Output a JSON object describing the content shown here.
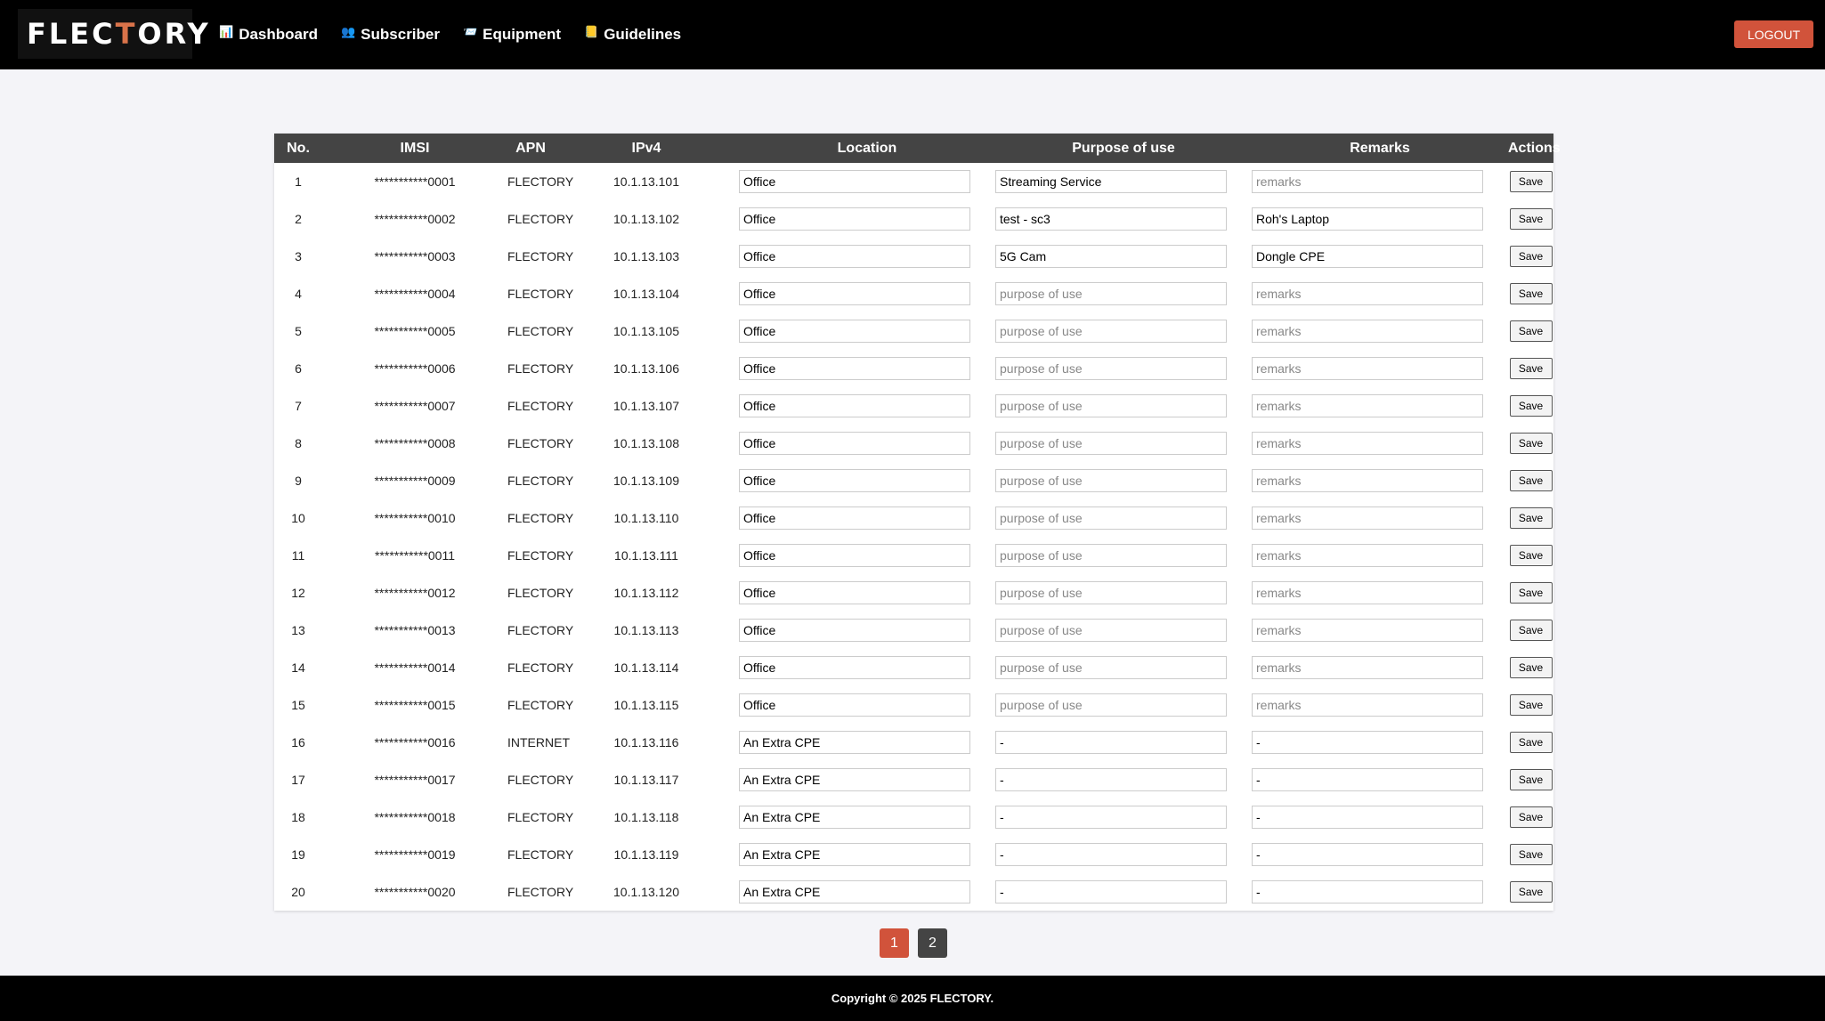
{
  "header": {
    "logo": {
      "part1": "FLEC",
      "accent": "T",
      "part2": "ORY"
    },
    "nav": [
      {
        "name": "nav-dashboard",
        "icon": "bar-chart-icon",
        "glyph": "📊",
        "label": "Dashboard"
      },
      {
        "name": "nav-subscriber",
        "icon": "users-icon",
        "glyph": "👥",
        "label": "Subscriber"
      },
      {
        "name": "nav-equipment",
        "icon": "mailbox-icon",
        "glyph": "📨",
        "label": "Equipment"
      },
      {
        "name": "nav-guidelines",
        "icon": "book-icon",
        "glyph": "📒",
        "label": "Guidelines"
      }
    ],
    "logout_label": "LOGOUT"
  },
  "table": {
    "columns": [
      "No.",
      "IMSI",
      "APN",
      "IPv4",
      "Location",
      "Purpose of use",
      "Remarks",
      "Actions"
    ],
    "placeholders": {
      "purpose": "purpose of use",
      "remarks": "remarks"
    },
    "save_label": "Save",
    "rows": [
      {
        "no": "1",
        "imsi": "***********0001",
        "apn": "FLECTORY",
        "ipv4": "10.1.13.101",
        "location": "Office",
        "purpose": "Streaming Service",
        "remarks": ""
      },
      {
        "no": "2",
        "imsi": "***********0002",
        "apn": "FLECTORY",
        "ipv4": "10.1.13.102",
        "location": "Office",
        "purpose": "test - sc3",
        "remarks": "Roh's Laptop"
      },
      {
        "no": "3",
        "imsi": "***********0003",
        "apn": "FLECTORY",
        "ipv4": "10.1.13.103",
        "location": "Office",
        "purpose": "5G Cam",
        "remarks": "Dongle CPE"
      },
      {
        "no": "4",
        "imsi": "***********0004",
        "apn": "FLECTORY",
        "ipv4": "10.1.13.104",
        "location": "Office",
        "purpose": "",
        "remarks": ""
      },
      {
        "no": "5",
        "imsi": "***********0005",
        "apn": "FLECTORY",
        "ipv4": "10.1.13.105",
        "location": "Office",
        "purpose": "",
        "remarks": ""
      },
      {
        "no": "6",
        "imsi": "***********0006",
        "apn": "FLECTORY",
        "ipv4": "10.1.13.106",
        "location": "Office",
        "purpose": "",
        "remarks": ""
      },
      {
        "no": "7",
        "imsi": "***********0007",
        "apn": "FLECTORY",
        "ipv4": "10.1.13.107",
        "location": "Office",
        "purpose": "",
        "remarks": ""
      },
      {
        "no": "8",
        "imsi": "***********0008",
        "apn": "FLECTORY",
        "ipv4": "10.1.13.108",
        "location": "Office",
        "purpose": "",
        "remarks": ""
      },
      {
        "no": "9",
        "imsi": "***********0009",
        "apn": "FLECTORY",
        "ipv4": "10.1.13.109",
        "location": "Office",
        "purpose": "",
        "remarks": ""
      },
      {
        "no": "10",
        "imsi": "***********0010",
        "apn": "FLECTORY",
        "ipv4": "10.1.13.110",
        "location": "Office",
        "purpose": "",
        "remarks": ""
      },
      {
        "no": "11",
        "imsi": "***********0011",
        "apn": "FLECTORY",
        "ipv4": "10.1.13.111",
        "location": "Office",
        "purpose": "",
        "remarks": ""
      },
      {
        "no": "12",
        "imsi": "***********0012",
        "apn": "FLECTORY",
        "ipv4": "10.1.13.112",
        "location": "Office",
        "purpose": "",
        "remarks": ""
      },
      {
        "no": "13",
        "imsi": "***********0013",
        "apn": "FLECTORY",
        "ipv4": "10.1.13.113",
        "location": "Office",
        "purpose": "",
        "remarks": ""
      },
      {
        "no": "14",
        "imsi": "***********0014",
        "apn": "FLECTORY",
        "ipv4": "10.1.13.114",
        "location": "Office",
        "purpose": "",
        "remarks": ""
      },
      {
        "no": "15",
        "imsi": "***********0015",
        "apn": "FLECTORY",
        "ipv4": "10.1.13.115",
        "location": "Office",
        "purpose": "",
        "remarks": ""
      },
      {
        "no": "16",
        "imsi": "***********0016",
        "apn": "INTERNET",
        "ipv4": "10.1.13.116",
        "location": "An Extra CPE",
        "purpose": "-",
        "remarks": "-"
      },
      {
        "no": "17",
        "imsi": "***********0017",
        "apn": "FLECTORY",
        "ipv4": "10.1.13.117",
        "location": "An Extra CPE",
        "purpose": "-",
        "remarks": "-"
      },
      {
        "no": "18",
        "imsi": "***********0018",
        "apn": "FLECTORY",
        "ipv4": "10.1.13.118",
        "location": "An Extra CPE",
        "purpose": "-",
        "remarks": "-"
      },
      {
        "no": "19",
        "imsi": "***********0019",
        "apn": "FLECTORY",
        "ipv4": "10.1.13.119",
        "location": "An Extra CPE",
        "purpose": "-",
        "remarks": "-"
      },
      {
        "no": "20",
        "imsi": "***********0020",
        "apn": "FLECTORY",
        "ipv4": "10.1.13.120",
        "location": "An Extra CPE",
        "purpose": "-",
        "remarks": "-"
      }
    ]
  },
  "pagination": {
    "pages": [
      "1",
      "2"
    ],
    "current": "1"
  },
  "footer": {
    "text": "Copyright © 2025 FLECTORY."
  },
  "colors": {
    "accent": "#d1533b",
    "header_bg": "#000000",
    "table_header_bg": "#444444",
    "page_bg": "#f4f4f8"
  }
}
